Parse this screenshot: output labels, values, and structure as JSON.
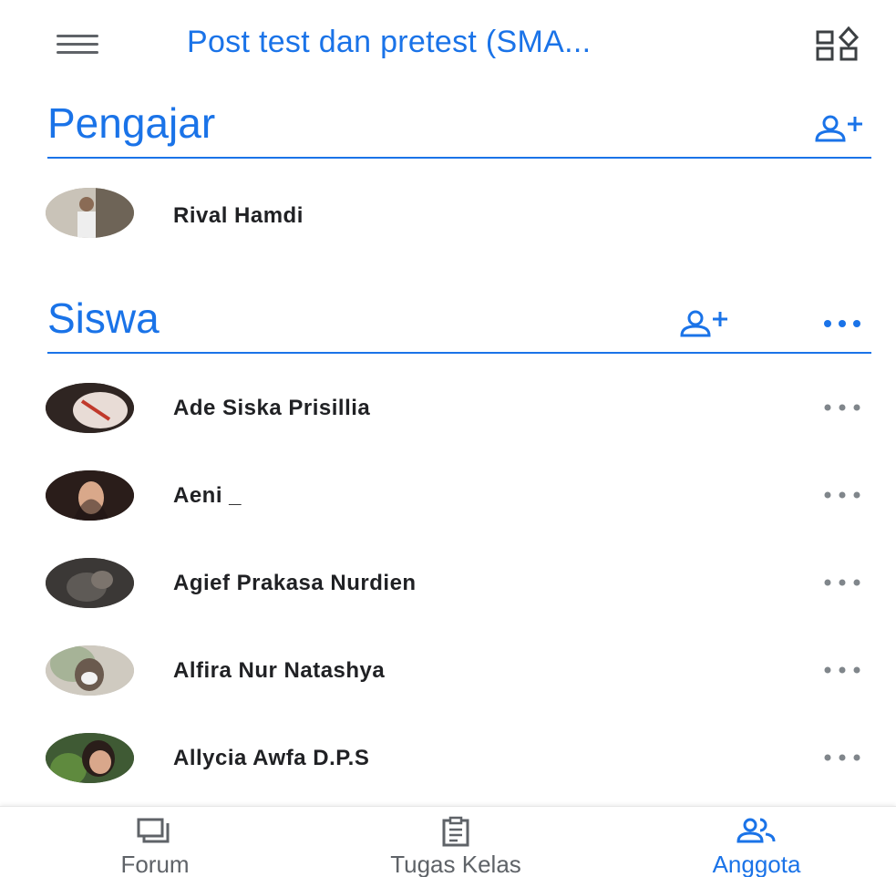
{
  "header": {
    "title": "Post test dan pretest (SMA...",
    "menu_icon": "hamburger-menu-icon",
    "classes_icon": "class-switcher-icon"
  },
  "teachers": {
    "heading": "Pengajar",
    "invite_icon": "add-person-icon",
    "members": [
      {
        "name": "Rival Hamdi"
      }
    ]
  },
  "students": {
    "heading": "Siswa",
    "invite_icon": "add-person-icon",
    "more_icon": "more-horizontal-icon",
    "members": [
      {
        "name": "Ade Siska Prisillia"
      },
      {
        "name": "Aeni _"
      },
      {
        "name": "Agief Prakasa Nurdien"
      },
      {
        "name": "Alfira Nur Natashya"
      },
      {
        "name": "Allycia Awfa D.P.S"
      }
    ]
  },
  "bottom_nav": {
    "items": [
      {
        "label": "Forum",
        "icon": "forum-icon",
        "active": false
      },
      {
        "label": "Tugas Kelas",
        "icon": "classwork-icon",
        "active": false
      },
      {
        "label": "Anggota",
        "icon": "people-icon",
        "active": true
      }
    ]
  },
  "colors": {
    "accent": "#1a73e8",
    "text": "#202124",
    "icon_gray": "#5f6368",
    "more_gray": "#80868b"
  }
}
